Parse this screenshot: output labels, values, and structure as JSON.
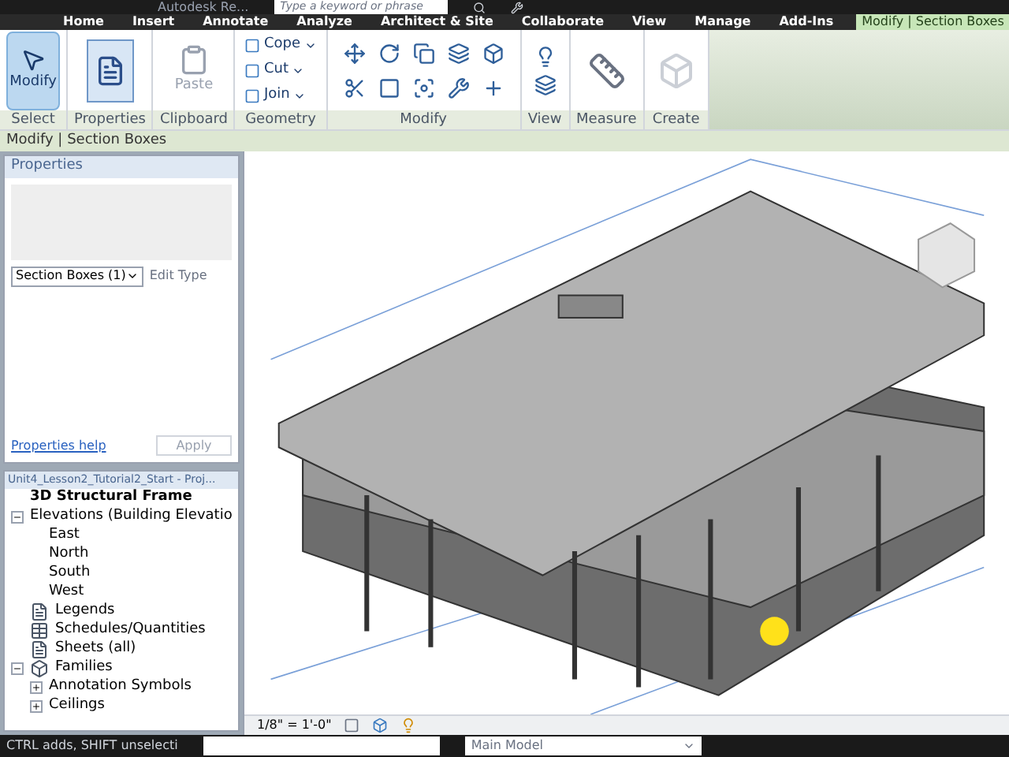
{
  "title_bar": {
    "app_title": "Autodesk Re...",
    "search_placeholder": "Type a keyword or phrase"
  },
  "tabs": [
    {
      "label": "Home",
      "selected": false
    },
    {
      "label": "Insert",
      "selected": false
    },
    {
      "label": "Annotate",
      "selected": false
    },
    {
      "label": "Analyze",
      "selected": false
    },
    {
      "label": "Architect & Site",
      "selected": false
    },
    {
      "label": "Collaborate",
      "selected": false
    },
    {
      "label": "View",
      "selected": false
    },
    {
      "label": "Manage",
      "selected": false
    },
    {
      "label": "Add-Ins",
      "selected": false
    },
    {
      "label": "Modify | Section Boxes",
      "selected": true
    }
  ],
  "ribbon_panels": [
    {
      "title": "Select",
      "tools": [
        {
          "label": "Modify",
          "kind": "large",
          "selected": true
        }
      ]
    },
    {
      "title": "Properties",
      "tools": [
        {
          "kind": "props"
        }
      ]
    },
    {
      "title": "Clipboard",
      "tools": [
        {
          "label": "Paste",
          "kind": "large",
          "disabled": true
        }
      ]
    },
    {
      "title": "Geometry",
      "tools": [
        {
          "label": "Cope",
          "kind": "small"
        },
        {
          "label": "Cut",
          "kind": "small"
        },
        {
          "label": "Join",
          "kind": "small"
        }
      ]
    },
    {
      "title": "Modify",
      "tools": [
        {
          "kind": "modify"
        }
      ]
    },
    {
      "title": "View",
      "tools": [
        {
          "kind": "view"
        }
      ]
    },
    {
      "title": "Measure",
      "tools": [
        {
          "kind": "measure"
        }
      ]
    },
    {
      "title": "Create",
      "tools": [
        {
          "kind": "create"
        }
      ]
    }
  ],
  "context_bar": "Modify | Section Boxes",
  "properties": {
    "title": "Properties",
    "type_selector": "Section Boxes (1)",
    "edit_type": "Edit Type",
    "edit_type_disabled": true,
    "help_link": "Properties help",
    "apply": "Apply",
    "apply_disabled": true
  },
  "project_browser": {
    "title": "Unit4_Lesson2_Tutorial2_Start - Proj...",
    "items": [
      {
        "label": "3D Structural Frame",
        "current": true
      },
      {
        "label": "Elevations (Building Elevatio",
        "expanded": true,
        "children": [
          {
            "label": "East",
            "current": false
          },
          {
            "label": "North",
            "current": false
          },
          {
            "label": "South",
            "current": false
          },
          {
            "label": "West",
            "current": false
          }
        ]
      },
      {
        "label": "Legends",
        "kind": "legends"
      },
      {
        "label": "Schedules/Quantities",
        "kind": "schedules"
      },
      {
        "label": "Sheets (all)",
        "kind": "sheets"
      },
      {
        "label": "Families",
        "kind": "families",
        "expanded": true,
        "children": [
          {
            "label": "Annotation Symbols",
            "expanded": false
          },
          {
            "label": "Ceilings",
            "expanded": false
          }
        ]
      }
    ]
  },
  "view_control": {
    "scale": "1/8\" = 1'-0\""
  },
  "status_bar": {
    "text": "CTRL adds, SHIFT unselecti",
    "model": "Main Model"
  }
}
